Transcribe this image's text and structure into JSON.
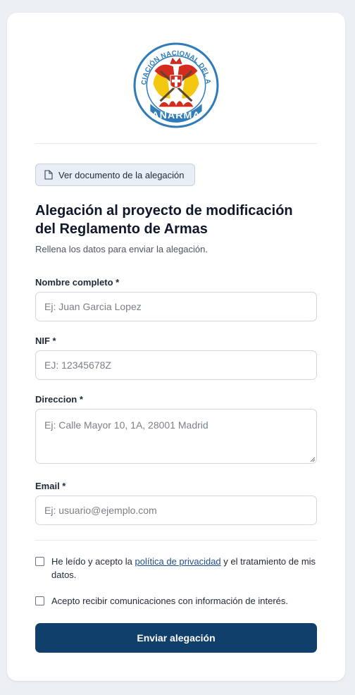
{
  "logo": {
    "ring_text": "ASOCIACIÓN NACIONAL DEL ARMA",
    "bottom_text": "ANARMA",
    "colors": {
      "ring": "#2f7cb8",
      "red": "#d52b1e",
      "yellow": "#f2c811"
    }
  },
  "doc_button": {
    "label": "Ver documento de la alegación",
    "icon": "document-icon"
  },
  "form": {
    "title": "Alegación al proyecto de modificación del Reglamento de Armas",
    "subtitle": "Rellena los datos para enviar la alegación.",
    "fields": {
      "nombre": {
        "label": "Nombre completo *",
        "placeholder": "Ej: Juan Garcia Lopez"
      },
      "nif": {
        "label": "NIF *",
        "placeholder": "EJ: 12345678Z"
      },
      "direccion": {
        "label": "Direccion *",
        "placeholder": "Ej: Calle Mayor 10, 1A, 28001 Madrid"
      },
      "email": {
        "label": "Email *",
        "placeholder": "Ej: usuario@ejemplo.com"
      }
    },
    "consent": {
      "privacy_prefix": "He leído y acepto la ",
      "privacy_link": "política de privacidad",
      "privacy_suffix": " y el tratamiento de mis datos.",
      "communications": "Acepto recibir comunicaciones con información de interés."
    },
    "submit_label": "Enviar alegación"
  },
  "colors": {
    "primary": "#103f6b",
    "link": "#1e4f8c",
    "background": "#eceff3"
  }
}
